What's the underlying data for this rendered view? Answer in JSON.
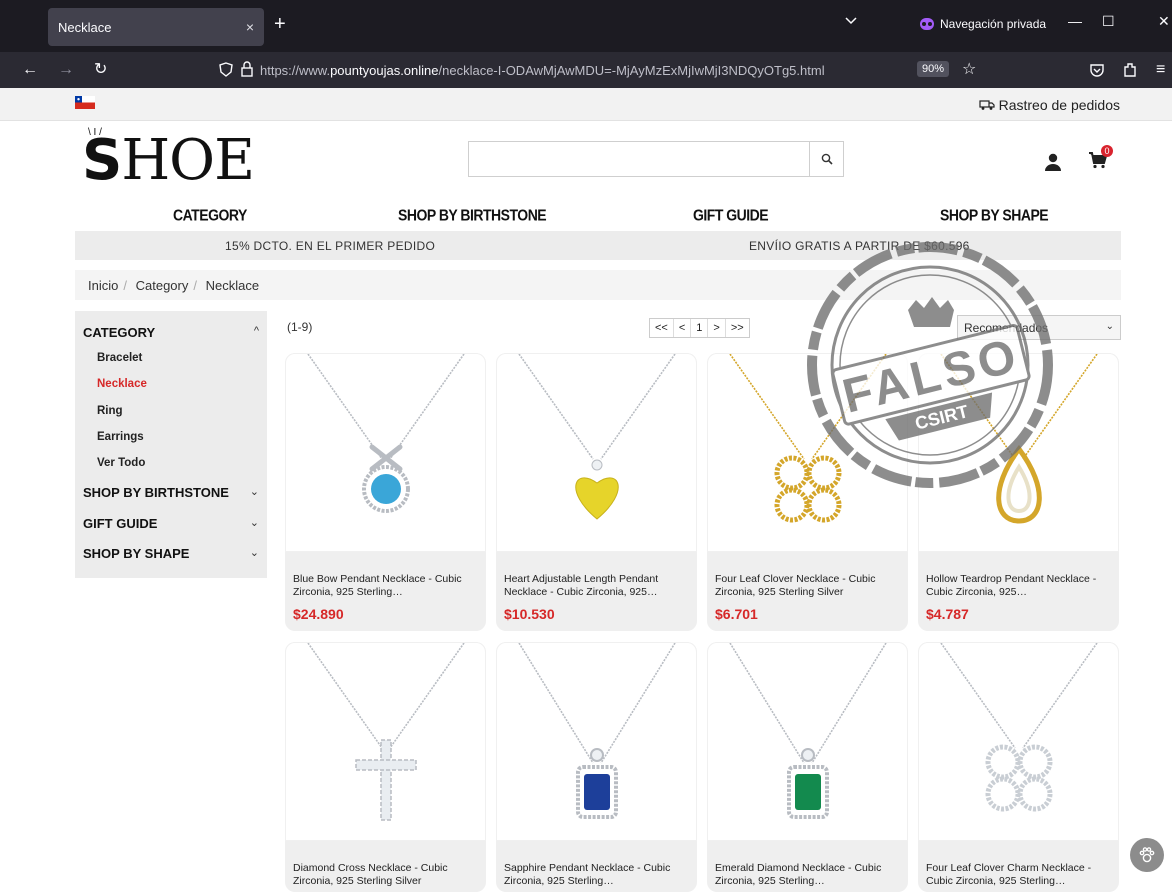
{
  "browser": {
    "tab_title": "Necklace",
    "tab_close": "×",
    "new_tab": "+",
    "private_label": "Navegación privada",
    "url_prefix": "https://www.",
    "url_domain": "pountyoujas.online",
    "url_path": "/necklace-I-ODAwMjAwMDU=-MjAyMzExMjIwMjI3NDQyOTg5.html",
    "zoom": "90%"
  },
  "site": {
    "track_orders": "Rastreo de pedidos",
    "logo_text": "HOE",
    "logo_s": "S",
    "search_value": "",
    "cart_count": "0"
  },
  "mainnav": {
    "items": [
      "CATEGORY",
      "SHOP BY BIRTHSTONE",
      "GIFT GUIDE",
      "SHOP BY SHAPE"
    ]
  },
  "promo": {
    "left": "15% DCTO. EN EL PRIMER PEDIDO",
    "right": "ENVÍIO GRATIS A PARTIR DE $60.596"
  },
  "breadcrumb": [
    "Inicio",
    "Category",
    "Necklace"
  ],
  "sidebar": {
    "sections": [
      {
        "label": "CATEGORY",
        "expanded": true,
        "chev": "^"
      },
      {
        "label": "SHOP BY BIRTHSTONE",
        "expanded": false,
        "chev": "⌄"
      },
      {
        "label": "GIFT GUIDE",
        "expanded": false,
        "chev": "⌄"
      },
      {
        "label": "SHOP BY SHAPE",
        "expanded": false,
        "chev": "⌄"
      }
    ],
    "category_items": [
      "Bracelet",
      "Necklace",
      "Ring",
      "Earrings",
      "Ver Todo"
    ],
    "active_item": "Necklace"
  },
  "listing": {
    "count": "(1-9)",
    "pager": [
      "<<",
      "<",
      "1",
      ">",
      ">>"
    ],
    "sort_value": "Recomendados"
  },
  "products": [
    {
      "title": "Blue Bow Pendant Necklace - Cubic Zirconia, 925 Sterling…",
      "price": "$24.890",
      "stone": "#3aa6d8",
      "metal": "#b8bcc2"
    },
    {
      "title": "Heart Adjustable Length Pendant Necklace - Cubic Zirconia, 925…",
      "price": "$10.530",
      "stone": "#e6d42a",
      "metal": "#b8bcc2"
    },
    {
      "title": "Four Leaf Clover Necklace - Cubic Zirconia, 925 Sterling Silver",
      "price": "$6.701",
      "stone": "#e8e1c8",
      "metal": "#d4a62a"
    },
    {
      "title": "Hollow Teardrop Pendant Necklace - Cubic Zirconia, 925…",
      "price": "$4.787",
      "stone": "#e8e1c8",
      "metal": "#d4a62a"
    },
    {
      "title": "Diamond Cross Necklace - Cubic Zirconia, 925 Sterling Silver",
      "price": "",
      "stone": "#e9edf1",
      "metal": "#b8bcc2"
    },
    {
      "title": "Sapphire Pendant Necklace - Cubic Zirconia, 925 Sterling…",
      "price": "",
      "stone": "#1d3f9a",
      "metal": "#b8bcc2"
    },
    {
      "title": "Emerald Diamond Necklace - Cubic Zirconia, 925 Sterling…",
      "price": "",
      "stone": "#138a4e",
      "metal": "#b8bcc2"
    },
    {
      "title": "Four Leaf Clover Charm Necklace - Cubic Zirconia, 925 Sterling…",
      "price": "",
      "stone": "#e9edf1",
      "metal": "#b8bcc2"
    }
  ],
  "stamp": {
    "main": "FALSO",
    "sub": "CSIRT"
  },
  "colors": {
    "accent_red": "#d62828",
    "chrome_dark": "#1c1b22",
    "chrome_bar": "#2b2a33"
  }
}
